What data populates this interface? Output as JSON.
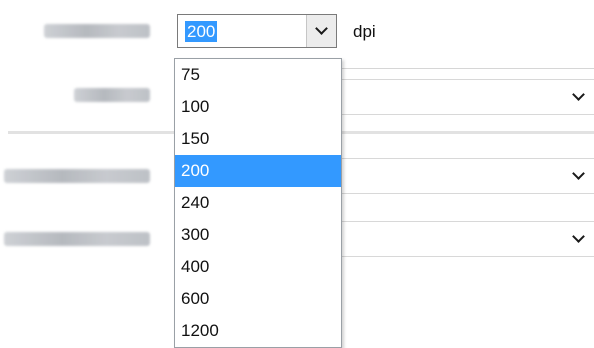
{
  "resolution": {
    "selected_value": "200",
    "unit": "dpi",
    "options": [
      "75",
      "100",
      "150",
      "200",
      "240",
      "300",
      "400",
      "600",
      "1200"
    ],
    "selected_index": 3
  },
  "colors": {
    "selection": "#3399ff",
    "border": "#7a7a7a"
  },
  "icons": {
    "dropdown": "chevron-down-icon"
  }
}
